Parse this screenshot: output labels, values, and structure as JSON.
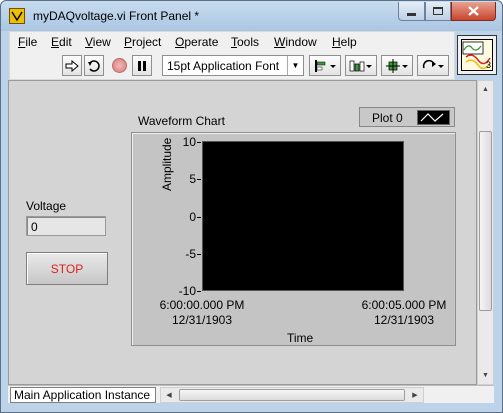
{
  "window": {
    "title": "myDAQvoltage.vi Front Panel *",
    "controls": {
      "minimize": "minimize",
      "maximize": "maximize",
      "close": "close"
    }
  },
  "menu": {
    "items": [
      {
        "label": "File",
        "mnemonic": "F",
        "rest": "ile"
      },
      {
        "label": "Edit",
        "mnemonic": "E",
        "rest": "dit"
      },
      {
        "label": "View",
        "mnemonic": "V",
        "rest": "iew"
      },
      {
        "label": "Project",
        "mnemonic": "P",
        "rest": "roject"
      },
      {
        "label": "Operate",
        "mnemonic": "O",
        "rest": "perate"
      },
      {
        "label": "Tools",
        "mnemonic": "T",
        "rest": "ools"
      },
      {
        "label": "Window",
        "mnemonic": "W",
        "rest": "indow"
      },
      {
        "label": "Help",
        "mnemonic": "H",
        "rest": "elp"
      }
    ]
  },
  "toolbar": {
    "run_icon": "run-arrow-icon",
    "run_continuous_icon": "run-continuously-icon",
    "abort_icon": "abort-icon",
    "pause_icon": "pause-icon",
    "font": "15pt Application Font",
    "align_icon": "align-objects-icon",
    "distribute_icon": "distribute-objects-icon",
    "resize_icon": "resize-objects-icon",
    "reorder_icon": "reorder-icon"
  },
  "connector_pane": {
    "terminal_count": "3"
  },
  "controls": {
    "voltage_label": "Voltage",
    "voltage_value": "0",
    "stop_label": "STOP"
  },
  "chart": {
    "label": "Waveform Chart",
    "legend_name": "Plot 0"
  },
  "statusbar": {
    "text": "Main Application Instance"
  },
  "colors": {
    "stop_text": "#e0201c",
    "plot_background": "#000000",
    "panel": "#d4d4d4"
  },
  "chart_data": {
    "type": "line",
    "title": "Waveform Chart",
    "xlabel": "Time",
    "ylabel": "Amplitude",
    "ylim": [
      -10,
      10
    ],
    "yticks": [
      "10",
      "5",
      "0",
      "-5",
      "-10"
    ],
    "xticks": [
      {
        "time": "6:00:00.000 PM",
        "date": "12/31/1903"
      },
      {
        "time": "6:00:05.000 PM",
        "date": "12/31/1903"
      }
    ],
    "series": [
      {
        "name": "Plot 0",
        "values": []
      }
    ],
    "legend": "top-right",
    "grid": false
  }
}
